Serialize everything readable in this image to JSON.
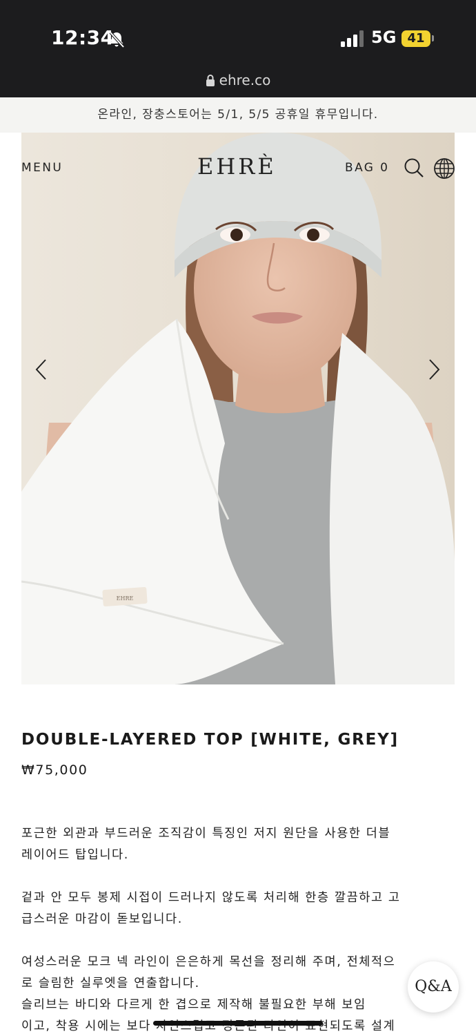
{
  "status_bar": {
    "time": "12:34",
    "network": "5G",
    "battery": "41",
    "url": "ehre.co",
    "icons": [
      "bell-slash-icon",
      "signal-icon",
      "lock-icon"
    ]
  },
  "announcement": "온라인, 장충스토어는 5/1, 5/5 공휴일 휴무입니다.",
  "nav": {
    "menu_label": "MENU",
    "logo": "EHRÈ",
    "bag_label": "BAG 0",
    "icons": [
      "search-icon",
      "globe-icon"
    ]
  },
  "gallery": {
    "icons": [
      "chevron-left-icon",
      "chevron-right-icon"
    ],
    "label_text": "EHRE"
  },
  "product": {
    "title": "DOUBLE-LAYERED TOP [WHITE, GREY]",
    "price": "₩75,000"
  },
  "description": {
    "p1_l1": "포근한 외관과 부드러운 조직감이 특징인 저지 원단을 사용한 더블",
    "p1_l2": "레이어드 탑입니다.",
    "p2_l1": "겉과 안 모두 봉제 시접이 드러나지 않도록 처리해 한층 깔끔하고 고",
    "p2_l2": "급스러운 마감이 돋보입니다.",
    "p3_l1": "여성스러운 모크 넥 라인이 은은하게 목선을 정리해 주며, 전체적으",
    "p3_l2": "로 슬림한 실루엣을 연출합니다.",
    "p3_l3": "슬리브는 바디와 다르게 한 겹으로 제작해 불필요한 부해 보임",
    "p3_l4": "이고, 착용 시에는 보다 자연스럽고 정돈된 라인이 표현되도록 설계"
  },
  "qa_button": "Q&A"
}
